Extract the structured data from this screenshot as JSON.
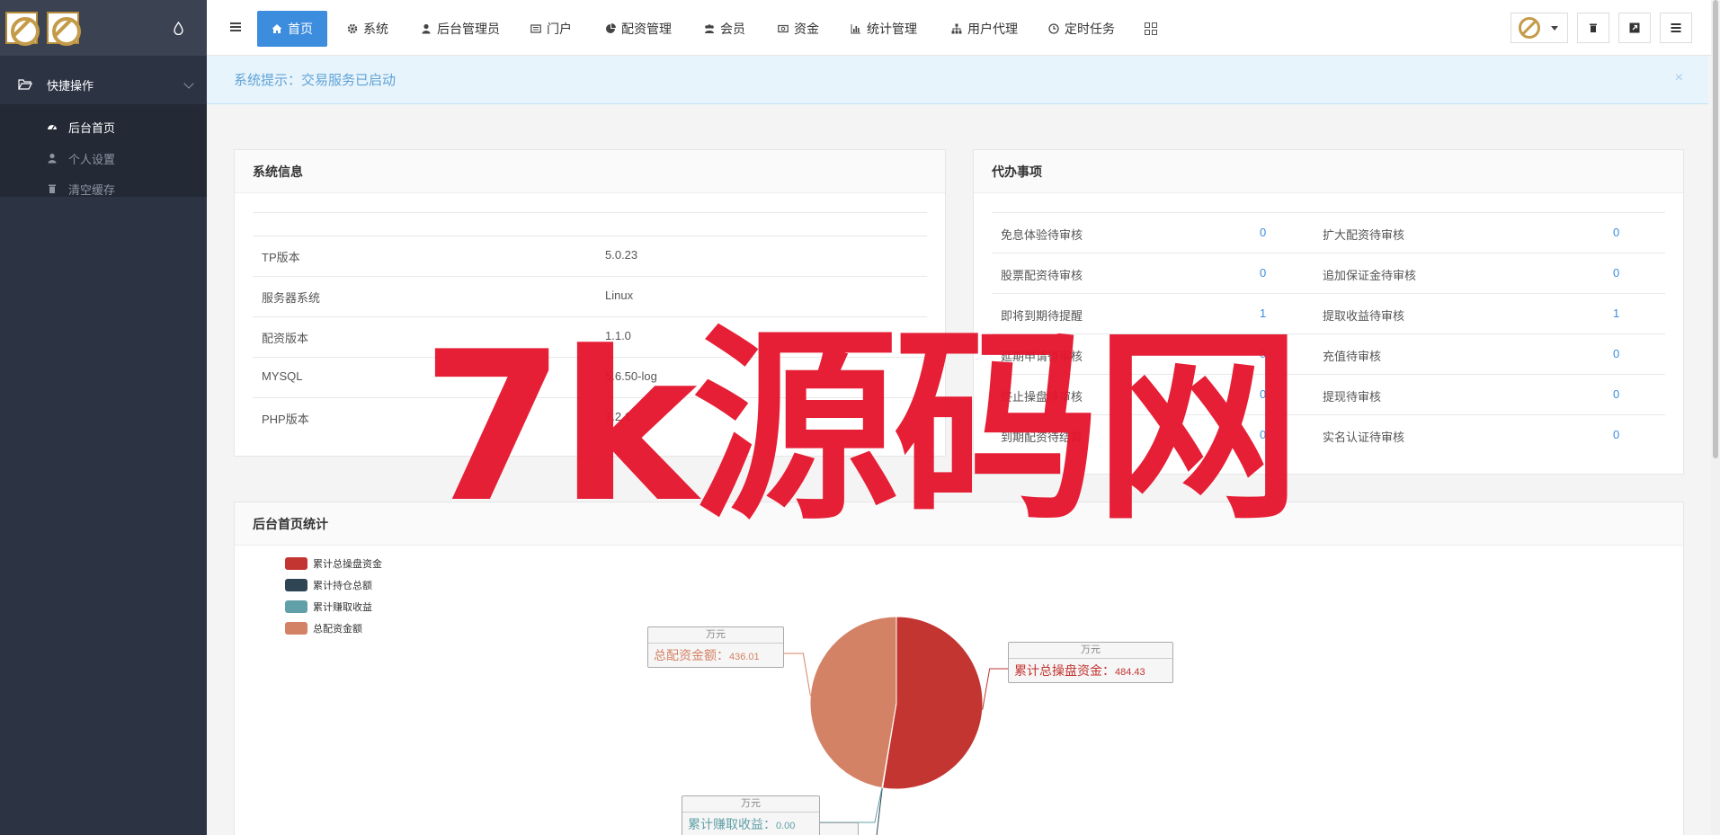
{
  "sidebar": {
    "menu_label": "快捷操作",
    "items": [
      {
        "label": "后台首页",
        "active": true
      },
      {
        "label": "个人设置",
        "active": false
      },
      {
        "label": "清空缓存",
        "active": false
      }
    ]
  },
  "topnav": {
    "items": [
      {
        "label": "首页",
        "icon": "home-icon",
        "active": true
      },
      {
        "label": "系统",
        "icon": "gear-icon"
      },
      {
        "label": "后台管理员",
        "icon": "user-icon"
      },
      {
        "label": "门户",
        "icon": "newspaper-icon"
      },
      {
        "label": "配资管理",
        "icon": "pie-icon"
      },
      {
        "label": "会员",
        "icon": "users-icon"
      },
      {
        "label": "资金",
        "icon": "money-icon"
      },
      {
        "label": "统计管理",
        "icon": "bar-chart-icon"
      },
      {
        "label": "用户代理",
        "icon": "sitemap-icon"
      },
      {
        "label": "定时任务",
        "icon": "clock-icon"
      }
    ]
  },
  "alert": {
    "text": "系统提示：交易服务已启动",
    "close": "×"
  },
  "sysinfo": {
    "title": "系统信息",
    "rows": [
      {
        "label": "TP版本",
        "value": "5.0.23"
      },
      {
        "label": "服务器系统",
        "value": "Linux"
      },
      {
        "label": "配资版本",
        "value": "1.1.0"
      },
      {
        "label": "MYSQL",
        "value": "5.6.50-log"
      },
      {
        "label": "PHP版本",
        "value": "7.2.1"
      }
    ]
  },
  "todo": {
    "title": "代办事项",
    "rows": [
      {
        "l1": "免息体验待审核",
        "v1": "0",
        "l2": "扩大配资待审核",
        "v2": "0"
      },
      {
        "l1": "股票配资待审核",
        "v1": "0",
        "l2": "追加保证金待审核",
        "v2": "0"
      },
      {
        "l1": "即将到期待提醒",
        "v1": "1",
        "l2": "提取收益待审核",
        "v2": "1"
      },
      {
        "l1": "延期申请待审核",
        "v1": "0",
        "l2": "充值待审核",
        "v2": "0"
      },
      {
        "l1": "终止操盘待审核",
        "v1": "0",
        "l2": "提现待审核",
        "v2": "0"
      },
      {
        "l1": "到期配资待结算",
        "v1": "0",
        "l2": "实名认证待审核",
        "v2": "0"
      }
    ]
  },
  "stats": {
    "title": "后台首页统计"
  },
  "chart_data": {
    "type": "pie",
    "unit": "万元",
    "slices": [
      {
        "name": "累计总操盘资金",
        "value": 484.43,
        "color": "#c23531"
      },
      {
        "name": "累计持仓总额",
        "value": 0.94,
        "color": "#2f4554"
      },
      {
        "name": "累计赚取收益",
        "value": 0.0,
        "color": "#61a0a8"
      },
      {
        "name": "总配资金额",
        "value": 436.01,
        "color": "#d48265"
      }
    ],
    "legend_position": "top-left"
  },
  "watermark": {
    "text": "7k源码网"
  }
}
